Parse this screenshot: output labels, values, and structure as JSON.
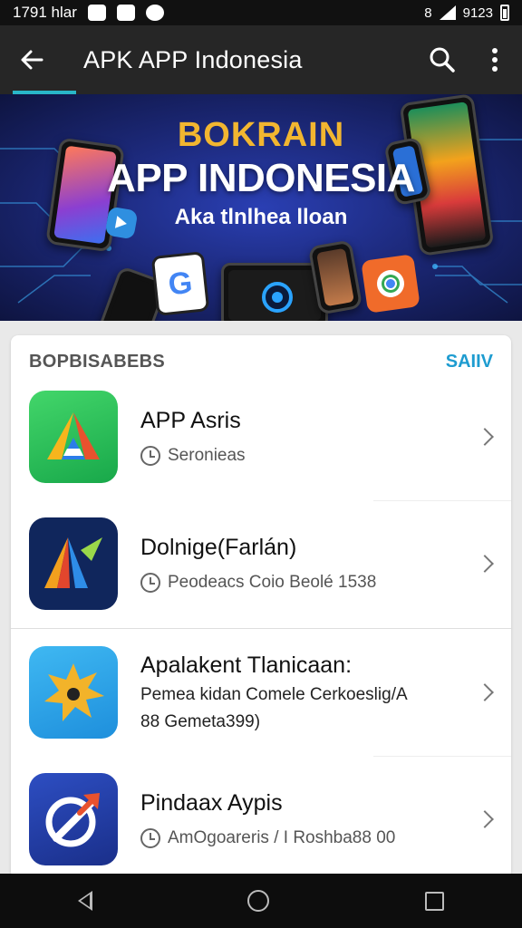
{
  "status_bar": {
    "time": "1791 hlar",
    "battery_text": "9123"
  },
  "app_bar": {
    "title": "APK APP Indonesia",
    "back_icon": "arrow-left-icon",
    "search_icon": "search-icon",
    "menu_icon": "more-vert-icon",
    "accent": "#29b6c8"
  },
  "banner": {
    "heading": "BOKRAIN",
    "title": "APP INDONESIA",
    "subtitle": "Aka tlnlhea lloan",
    "heading_color": "#f2b630"
  },
  "list": {
    "section_title": "BOPBISABEBS",
    "see_all": "SAIIV",
    "items": [
      {
        "title": "APP Asris",
        "subtitle": "Seronieas"
      },
      {
        "title": "Dolnige(Farlán)",
        "subtitle": "Peodeacs Coio Beolé 1538"
      },
      {
        "title": "Apalakent Tlanicaan:",
        "subtitle": "Pemea kidan Comele Cerkoeslig/A",
        "subtitle2": "88 Gemeta399)"
      },
      {
        "title": "Pindaax Aypis",
        "subtitle": "AmOgoareris / I Roshba88 00"
      }
    ]
  },
  "colors": {
    "link": "#1e9cd0",
    "app_bar_bg": "#262626"
  }
}
